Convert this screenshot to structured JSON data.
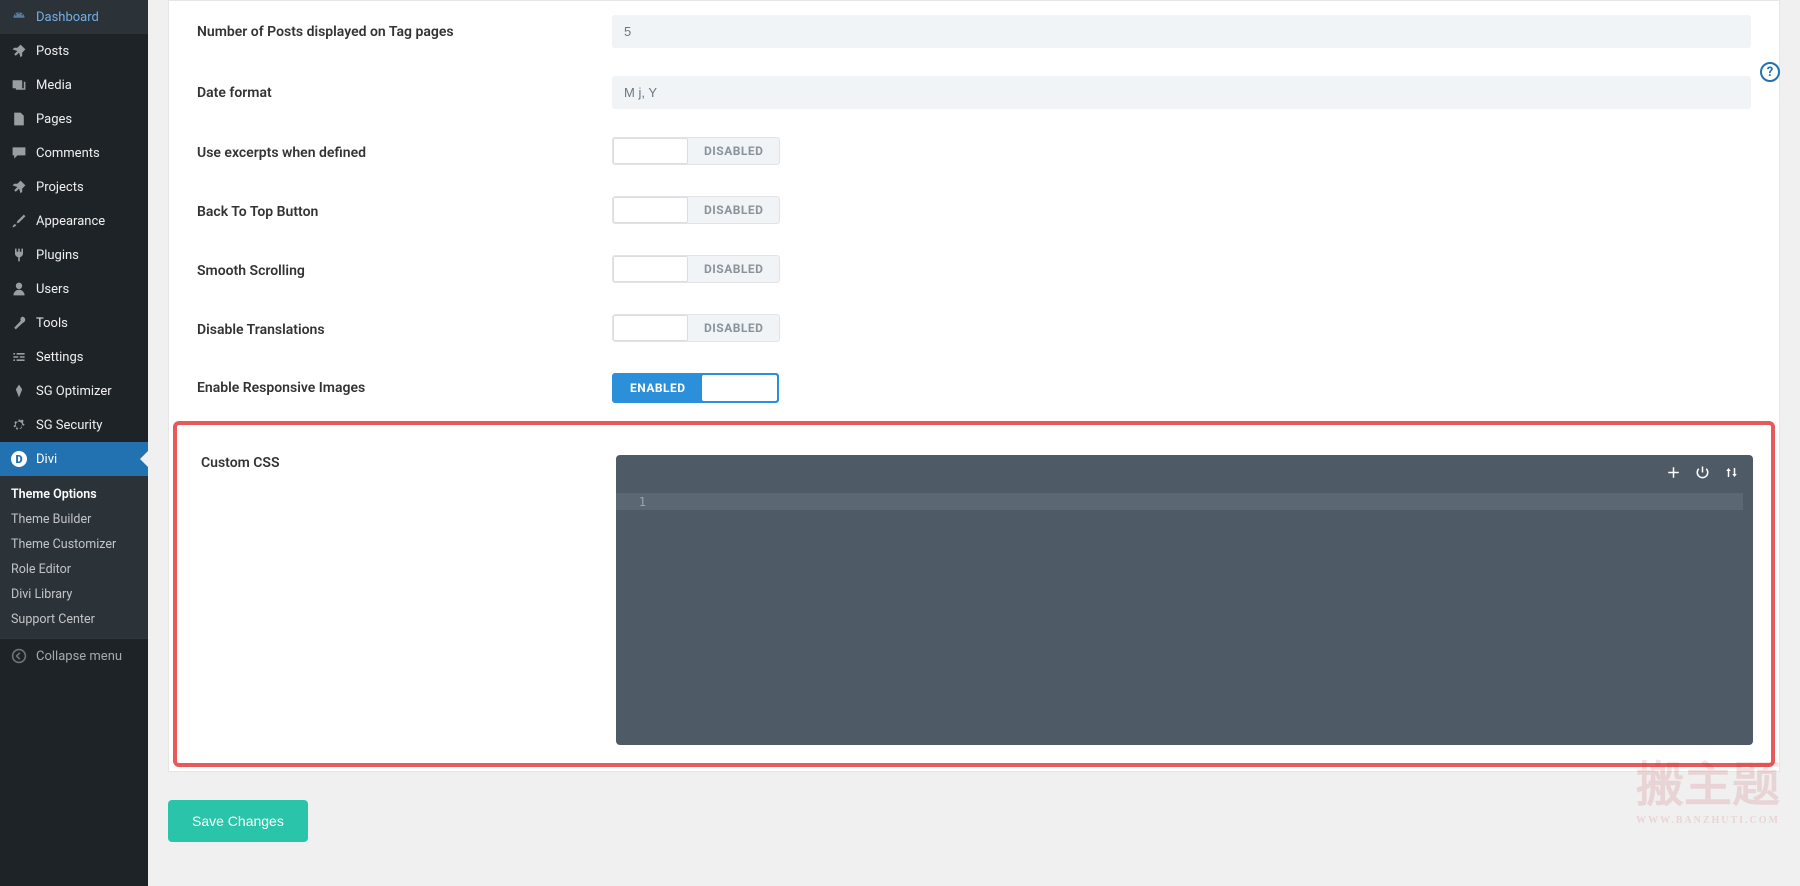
{
  "sidebar": {
    "items": [
      {
        "label": "Dashboard",
        "icon": "dashboard"
      },
      {
        "label": "Posts",
        "icon": "pin"
      },
      {
        "label": "Media",
        "icon": "media"
      },
      {
        "label": "Pages",
        "icon": "pages"
      },
      {
        "label": "Comments",
        "icon": "comments"
      },
      {
        "label": "Projects",
        "icon": "pin"
      },
      {
        "label": "Appearance",
        "icon": "brush"
      },
      {
        "label": "Plugins",
        "icon": "plug"
      },
      {
        "label": "Users",
        "icon": "user"
      },
      {
        "label": "Tools",
        "icon": "wrench"
      },
      {
        "label": "Settings",
        "icon": "settings"
      },
      {
        "label": "SG Optimizer",
        "icon": "rocket"
      },
      {
        "label": "SG Security",
        "icon": "gear"
      },
      {
        "label": "Divi",
        "icon": "divi"
      }
    ],
    "submenu": [
      "Theme Options",
      "Theme Builder",
      "Theme Customizer",
      "Role Editor",
      "Divi Library",
      "Support Center"
    ],
    "collapse": "Collapse menu"
  },
  "options": {
    "num_posts_tag": {
      "label": "Number of Posts displayed on Tag pages",
      "value": "5"
    },
    "date_format": {
      "label": "Date format",
      "value": "M j, Y"
    },
    "use_excerpts": {
      "label": "Use excerpts when defined",
      "state": "DISABLED"
    },
    "back_to_top": {
      "label": "Back To Top Button",
      "state": "DISABLED"
    },
    "smooth_scroll": {
      "label": "Smooth Scrolling",
      "state": "DISABLED"
    },
    "disable_translations": {
      "label": "Disable Translations",
      "state": "DISABLED"
    },
    "responsive_images": {
      "label": "Enable Responsive Images",
      "state": "ENABLED"
    },
    "custom_css": {
      "label": "Custom CSS",
      "line_number": "1"
    }
  },
  "save_button": "Save Changes",
  "help": "?",
  "watermark": {
    "text": "搬主题",
    "url": "WWW.BANZHUTI.COM"
  }
}
